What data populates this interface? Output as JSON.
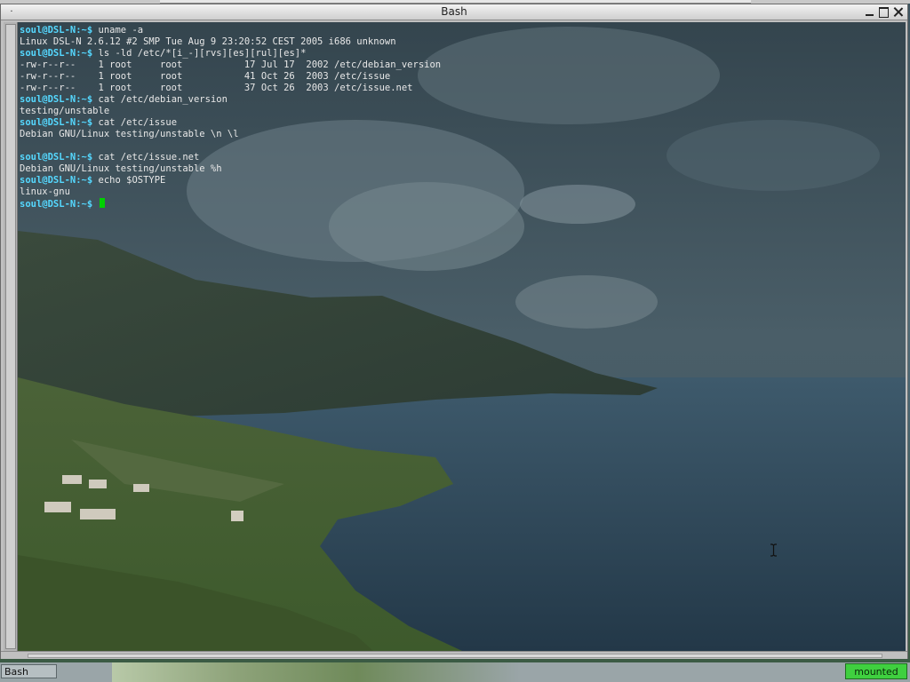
{
  "window": {
    "title": "Bash",
    "menu_glyph": "·"
  },
  "terminal": {
    "lines": [
      {
        "prompt": "soul@DSL-N:~$",
        "text": " uname -a"
      },
      {
        "prompt": "",
        "text": "Linux DSL-N 2.6.12 #2 SMP Tue Aug 9 23:20:52 CEST 2005 i686 unknown"
      },
      {
        "prompt": "soul@DSL-N:~$",
        "text": " ls -ld /etc/*[i_-][rvs][es][rul][es]*"
      },
      {
        "prompt": "",
        "text": "-rw-r--r--    1 root     root           17 Jul 17  2002 /etc/debian_version"
      },
      {
        "prompt": "",
        "text": "-rw-r--r--    1 root     root           41 Oct 26  2003 /etc/issue"
      },
      {
        "prompt": "",
        "text": "-rw-r--r--    1 root     root           37 Oct 26  2003 /etc/issue.net"
      },
      {
        "prompt": "soul@DSL-N:~$",
        "text": " cat /etc/debian_version"
      },
      {
        "prompt": "",
        "text": "testing/unstable"
      },
      {
        "prompt": "soul@DSL-N:~$",
        "text": " cat /etc/issue"
      },
      {
        "prompt": "",
        "text": "Debian GNU/Linux testing/unstable \\n \\l"
      },
      {
        "prompt": "",
        "text": ""
      },
      {
        "prompt": "soul@DSL-N:~$",
        "text": " cat /etc/issue.net"
      },
      {
        "prompt": "",
        "text": "Debian GNU/Linux testing/unstable %h"
      },
      {
        "prompt": "soul@DSL-N:~$",
        "text": " echo $OSTYPE"
      },
      {
        "prompt": "",
        "text": "linux-gnu"
      },
      {
        "prompt": "soul@DSL-N:~$",
        "text": " ",
        "cursor": true
      }
    ],
    "colors": {
      "prompt": "#55d8ff",
      "text": "#e8e8e8",
      "cursor": "#00d000"
    }
  },
  "taskbar": {
    "task_label": "Bash",
    "status_label": "mounted",
    "status_color": "#3fd03f"
  }
}
